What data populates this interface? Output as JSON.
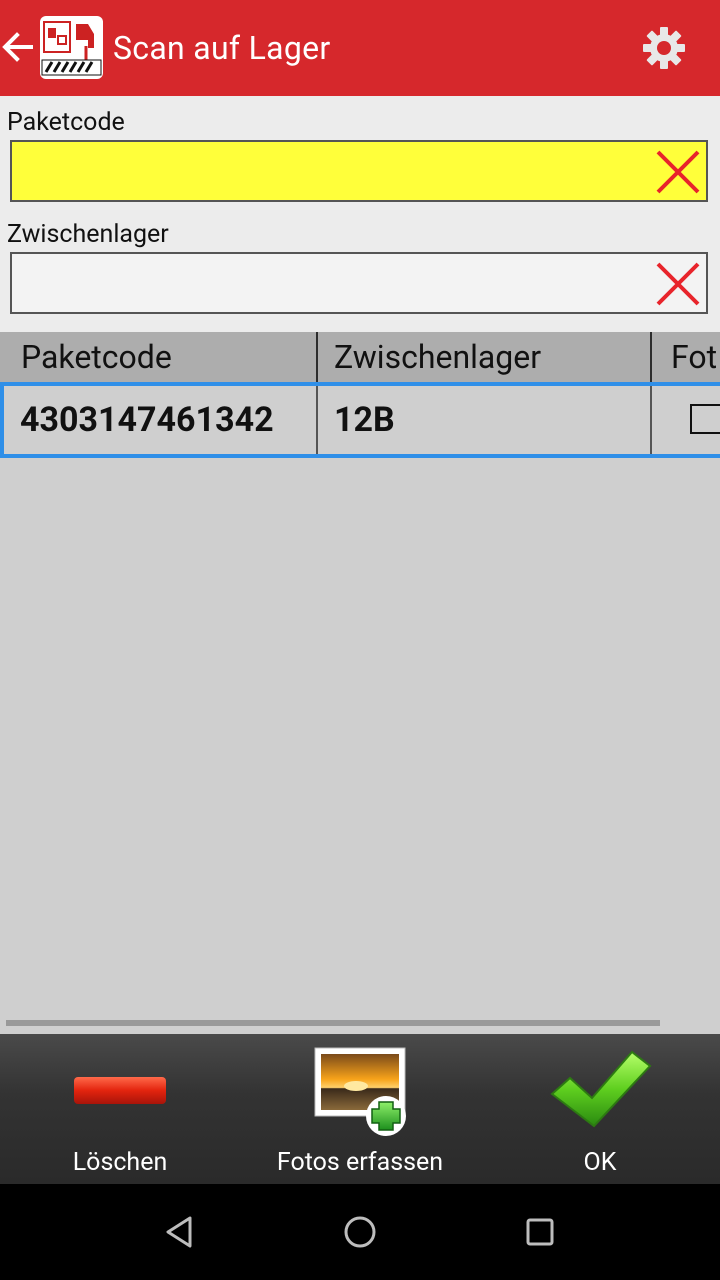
{
  "app_bar": {
    "title": "Scan auf Lager",
    "color": "#d6282c",
    "back_icon": "arrow-left-icon",
    "settings_icon": "gear-icon"
  },
  "form": {
    "paketcode": {
      "label": "Paketcode",
      "value": "",
      "background": "#ffff3a"
    },
    "zwischenlager": {
      "label": "Zwischenlager",
      "value": "",
      "background": "#f3f3f3"
    },
    "clear_icon": "red-x-icon"
  },
  "table": {
    "columns": [
      "Paketcode",
      "Zwischenlager",
      "Fot"
    ],
    "rows": [
      {
        "paketcode": "4303147461342",
        "zwischenlager": "12B",
        "foto_checked": false
      }
    ],
    "selection_color": "#2f8fe8"
  },
  "toolbar": {
    "items": [
      {
        "label": "Löschen",
        "icon": "minus-icon"
      },
      {
        "label": "Fotos erfassen",
        "icon": "add-photo-icon"
      },
      {
        "label": "OK",
        "icon": "checkmark-icon"
      }
    ]
  },
  "system_nav": {
    "back": "triangle-back-icon",
    "home": "circle-home-icon",
    "recents": "square-recents-icon"
  }
}
